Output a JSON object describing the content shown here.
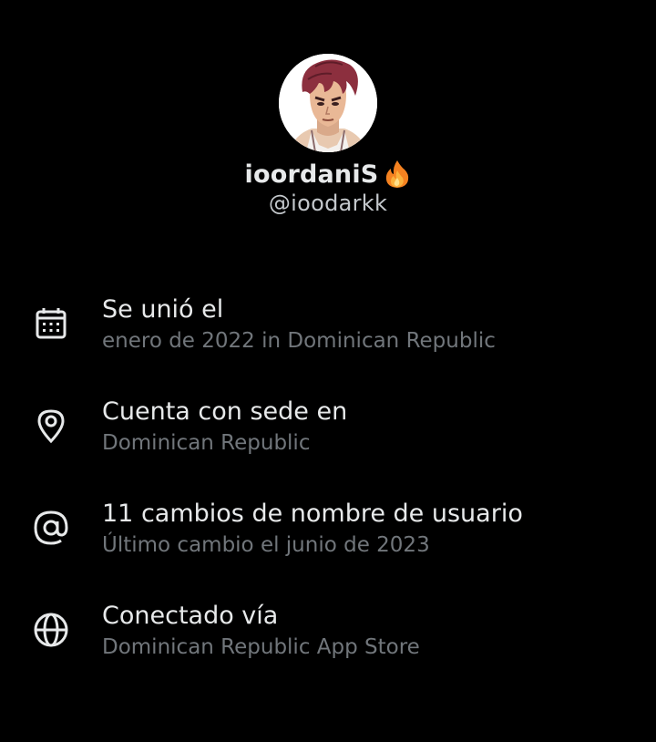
{
  "profile": {
    "display_name": "ioordaniS",
    "emoji_icon": "fire-icon",
    "handle": "@ioodarkk",
    "avatar_icon": "anime-character-avatar"
  },
  "info": [
    {
      "icon": "calendar-icon",
      "title": "Se unió el",
      "subtitle": "enero de 2022 in Dominican Republic"
    },
    {
      "icon": "location-pin-icon",
      "title": "Cuenta con sede en",
      "subtitle": "Dominican Republic"
    },
    {
      "icon": "at-sign-icon",
      "title": "11 cambios de nombre de usuario",
      "subtitle": "Último cambio el junio de 2023"
    },
    {
      "icon": "globe-icon",
      "title": "Conectado vía",
      "subtitle": "Dominican Republic App Store"
    }
  ],
  "colors": {
    "background": "#000000",
    "primary_text": "#e7e9ea",
    "secondary_text": "#71767b",
    "icon": "#e7e9ea"
  }
}
